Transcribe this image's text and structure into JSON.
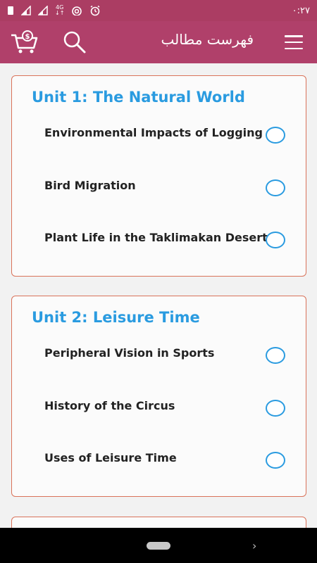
{
  "status_bar": {
    "time": "۰:۲۷",
    "network": "4G",
    "icons": [
      "sim-icon",
      "signal-icon",
      "signal-icon",
      "data-arrows-icon",
      "wifi-icon",
      "alarm-icon"
    ]
  },
  "app_bar": {
    "title": "فهرست مطالب",
    "icons": [
      "cart-icon",
      "search-icon",
      "menu-icon"
    ]
  },
  "units": [
    {
      "title": "Unit 1: The Natural World",
      "lessons": [
        "Environmental Impacts of Logging",
        "Bird Migration",
        "Plant Life in the Taklimakan Desert"
      ]
    },
    {
      "title": "Unit 2: Leisure Time",
      "lessons": [
        "Peripheral Vision in Sports",
        "History of the Circus",
        "Uses of Leisure Time"
      ]
    }
  ],
  "colors": {
    "primary": "#b0406a",
    "accent": "#2a9be0",
    "card_border": "#d9735a"
  }
}
